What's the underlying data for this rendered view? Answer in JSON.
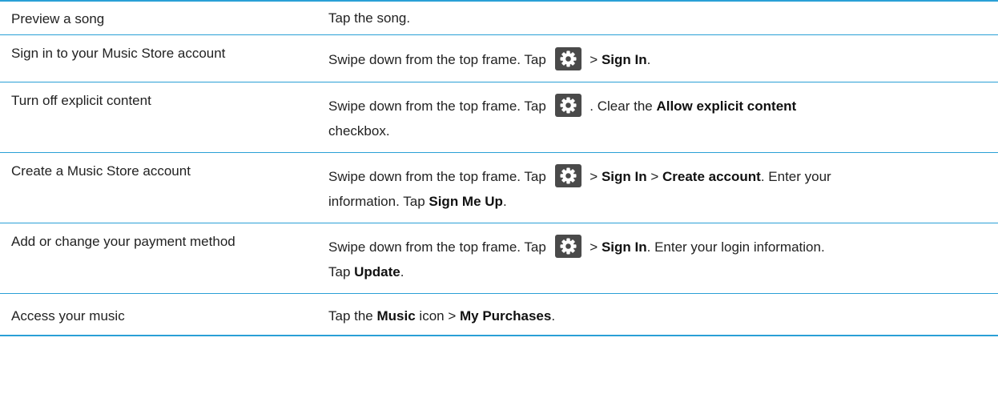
{
  "rows": [
    {
      "task": "Preview a song",
      "step_1": "Tap the song."
    },
    {
      "task": "Sign in to your Music Store account",
      "step_1": "Swipe down from the top frame. Tap",
      "step_2": "> ",
      "step_3": "Sign In",
      "step_4": "."
    },
    {
      "task": "Turn off explicit content",
      "step_1": "Swipe down from the top frame. Tap",
      "step_2": ". Clear the ",
      "step_3": "Allow explicit content",
      "step_4": "checkbox."
    },
    {
      "task": "Create a Music Store account",
      "step_1": "Swipe down from the top frame. Tap",
      "step_2": "> ",
      "step_3": "Sign In",
      "step_4": " > ",
      "step_5": "Create account",
      "step_6": ". Enter your",
      "step_7": "information. Tap ",
      "step_8": "Sign Me Up",
      "step_9": "."
    },
    {
      "task": "Add or change your payment method",
      "step_1": "Swipe down from the top frame. Tap",
      "step_2": "> ",
      "step_3": "Sign In",
      "step_4": ". Enter your login information.",
      "step_5": "Tap ",
      "step_6": "Update",
      "step_7": "."
    },
    {
      "task": "Access your music",
      "step_1": "Tap the ",
      "step_2": "Music",
      "step_3": " icon > ",
      "step_4": "My Purchases",
      "step_5": "."
    }
  ],
  "icons": {
    "settings": "gear-icon"
  },
  "colors": {
    "rule": "#2aa0d6",
    "icon_bg": "#4a4a4a",
    "text": "#222222"
  }
}
